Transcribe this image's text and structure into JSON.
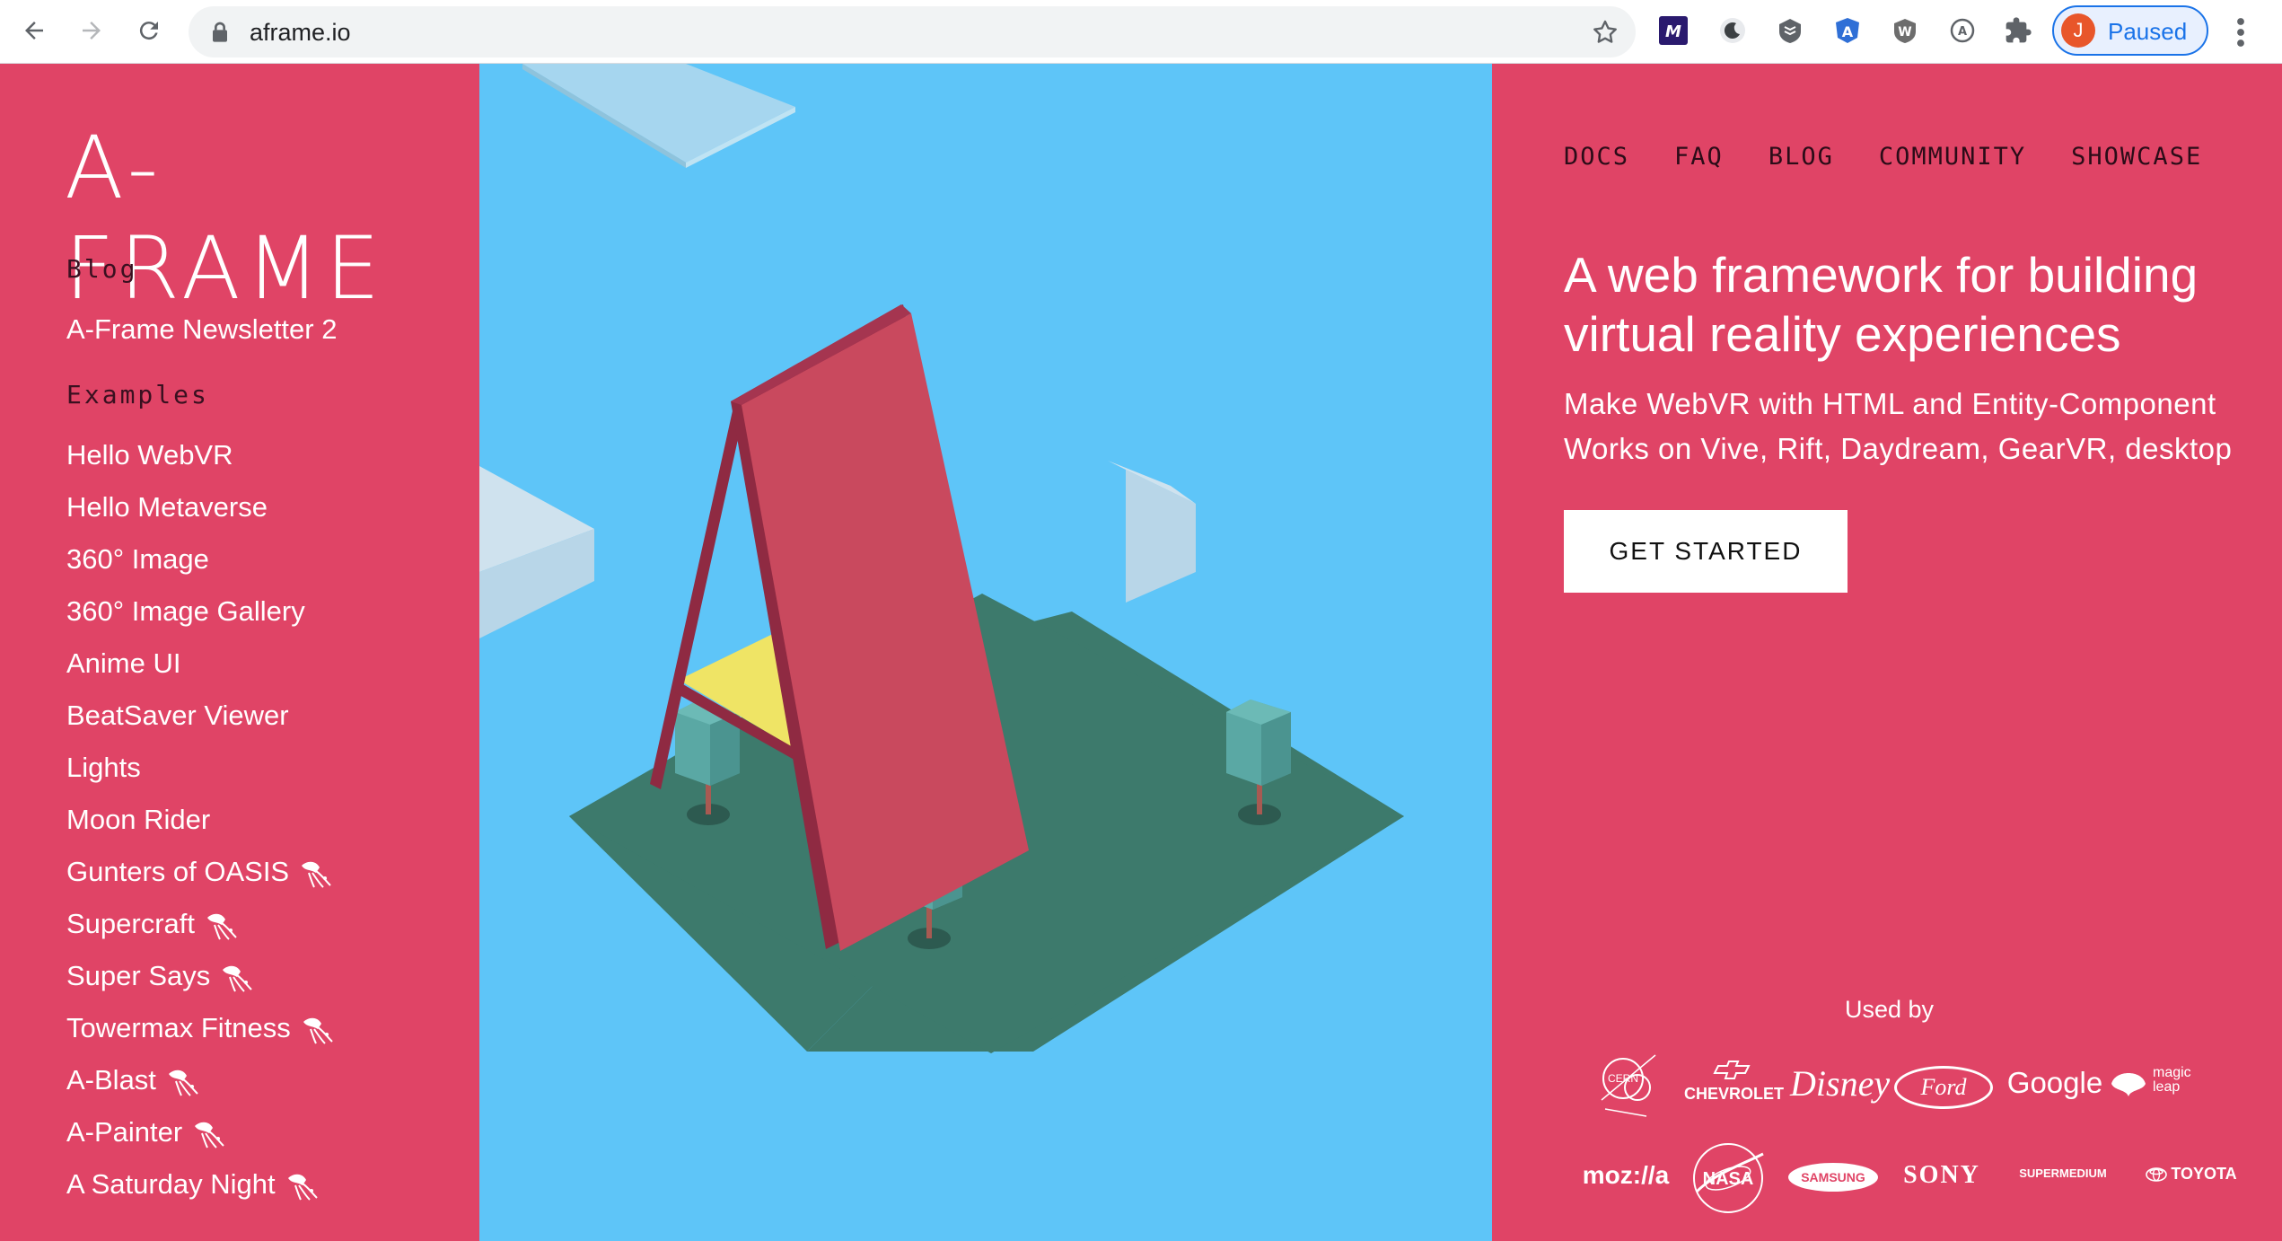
{
  "browser": {
    "url": "aframe.io",
    "profile_initial": "J",
    "profile_status": "Paused",
    "extensions": [
      "mailmeteor-icon",
      "dark-mode-icon",
      "shield-stack-icon",
      "angular-icon",
      "w-extension-icon",
      "a-circle-icon",
      "puzzle-icon"
    ]
  },
  "sidebar": {
    "logo": "A-FRAME",
    "blog_title": "Blog",
    "blog_links": [
      "A-Frame Newsletter 2"
    ],
    "examples_title": "Examples",
    "examples": [
      {
        "label": "Hello WebVR",
        "squid": false
      },
      {
        "label": "Hello Metaverse",
        "squid": false
      },
      {
        "label": "360° Image",
        "squid": false
      },
      {
        "label": "360° Image Gallery",
        "squid": false
      },
      {
        "label": "Anime UI",
        "squid": false
      },
      {
        "label": "BeatSaver Viewer",
        "squid": false
      },
      {
        "label": "Lights",
        "squid": false
      },
      {
        "label": "Moon Rider",
        "squid": false
      },
      {
        "label": "Gunters of OASIS",
        "squid": true
      },
      {
        "label": "Supercraft",
        "squid": true
      },
      {
        "label": "Super Says",
        "squid": true
      },
      {
        "label": "Towermax Fitness",
        "squid": true
      },
      {
        "label": "A-Blast",
        "squid": true
      },
      {
        "label": "A-Painter",
        "squid": true
      },
      {
        "label": "A Saturday Night",
        "squid": true
      }
    ]
  },
  "nav": [
    "DOCS",
    "FAQ",
    "BLOG",
    "COMMUNITY",
    "SHOWCASE"
  ],
  "hero": {
    "headline": "A web framework for building virtual reality experiences",
    "subline_1": "Make WebVR with HTML and Entity-Component",
    "subline_2": "Works on Vive, Rift, Daydream, GearVR, desktop",
    "cta": "GET STARTED"
  },
  "used_by": {
    "title": "Used by",
    "row1": [
      "CERN",
      "CHEVROLET",
      "Disney",
      "Ford",
      "Google",
      "magic leap"
    ],
    "row2": [
      "moz://a",
      "NASA",
      "SAMSUNG",
      "SONY",
      "SUPERMEDIUM",
      "TOYOTA"
    ]
  },
  "colors": {
    "brand_pink": "#e04466",
    "hero_sky": "#5ec5f8",
    "ground": "#3d7a6c",
    "a_face": "#c9495e",
    "a_edge": "#8f2a42",
    "a_triangle": "#efe465"
  }
}
